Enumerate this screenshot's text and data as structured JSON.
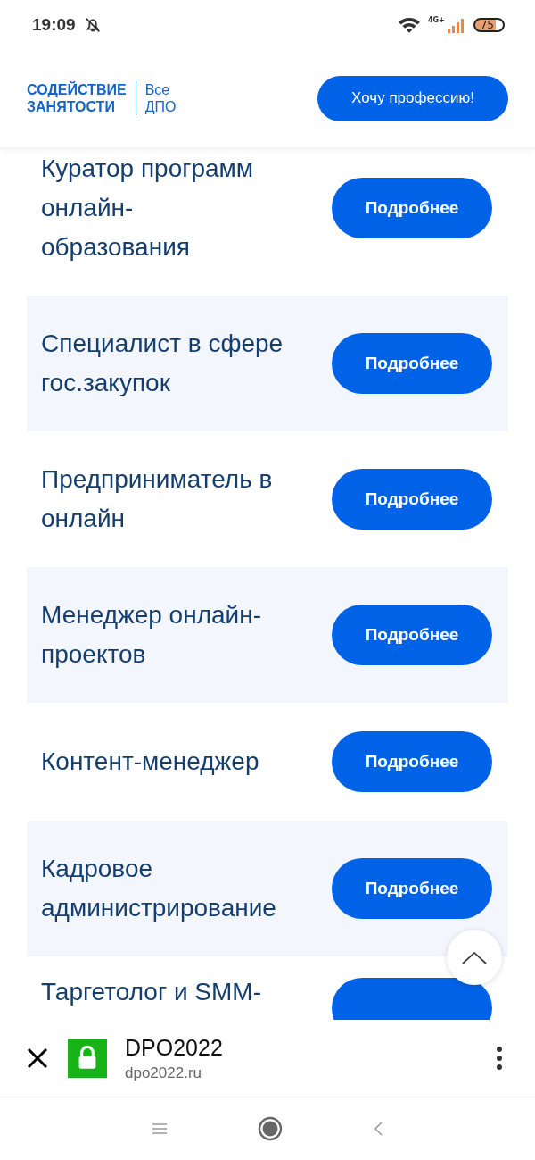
{
  "status_bar": {
    "time": "19:09",
    "network": "4G+",
    "battery": "75"
  },
  "header": {
    "logo_primary": [
      "СОДЕЙСТВИЕ",
      "ЗАНЯТОСТИ"
    ],
    "logo_secondary": [
      "Все",
      "ДПО"
    ],
    "cta_button": "Хочу профессию!"
  },
  "programs": [
    {
      "title": "Куратор программ онлайн-образования",
      "button": "Подробнее"
    },
    {
      "title": "Специалист в сфере гос.закупок",
      "button": "Подробнее"
    },
    {
      "title": "Предприниматель в онлайн",
      "button": "Подробнее"
    },
    {
      "title": "Менеджер онлайн-проектов",
      "button": "Подробнее"
    },
    {
      "title": "Контент-менеджер",
      "button": "Подробнее"
    },
    {
      "title": "Кадровое администрирование",
      "button": "Подробнее"
    },
    {
      "title": "Таргетолог и SMM-"
    }
  ],
  "browser_bar": {
    "title": "DPO2022",
    "url": "dpo2022.ru"
  }
}
